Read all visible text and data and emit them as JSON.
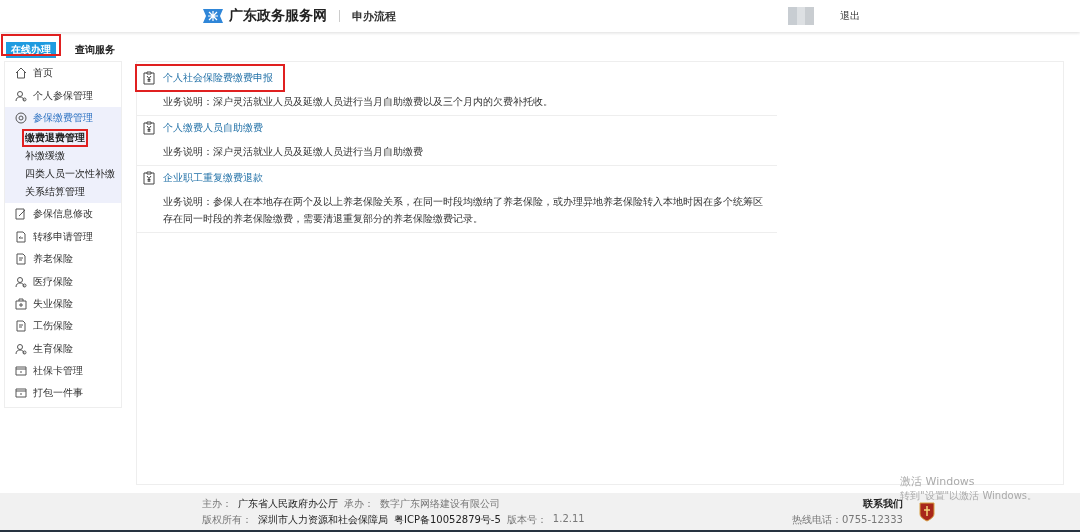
{
  "header": {
    "site_name": "广东政务服务网",
    "section": "申办流程",
    "logout": "退出"
  },
  "tabs": [
    {
      "label": "在线办理",
      "selected": true,
      "annotated": true
    },
    {
      "label": "查询服务",
      "selected": false,
      "annotated": false
    }
  ],
  "sidebar": {
    "items": [
      {
        "label": "首页",
        "kind": "home",
        "expanded": false
      },
      {
        "label": "个人参保管理",
        "kind": "person",
        "expanded": false
      },
      {
        "label": "参保缴费管理",
        "kind": "coin",
        "expanded": true,
        "children": [
          {
            "label": "缴费退费管理",
            "selected": true,
            "annotated": true
          },
          {
            "label": "补缴缓缴",
            "selected": false,
            "annotated": false
          },
          {
            "label": "四类人员一次性补缴",
            "selected": false,
            "annotated": false
          },
          {
            "label": "关系结算管理",
            "selected": false,
            "annotated": false
          }
        ]
      },
      {
        "label": "参保信息修改",
        "kind": "edit",
        "expanded": false
      },
      {
        "label": "转移申请管理",
        "kind": "transfer",
        "expanded": false
      },
      {
        "label": "养老保险",
        "kind": "doc",
        "expanded": false
      },
      {
        "label": "医疗保险",
        "kind": "person",
        "expanded": false
      },
      {
        "label": "失业保险",
        "kind": "bag",
        "expanded": false
      },
      {
        "label": "工伤保险",
        "kind": "doc",
        "expanded": false
      },
      {
        "label": "生育保险",
        "kind": "person",
        "expanded": false
      },
      {
        "label": "社保卡管理",
        "kind": "card",
        "expanded": false
      },
      {
        "label": "打包一件事",
        "kind": "card",
        "expanded": false
      }
    ]
  },
  "services": [
    {
      "title": "个人社会保险费缴费申报",
      "description": "业务说明：深户灵活就业人员及延缴人员进行当月自助缴费以及三个月内的欠费补托收。",
      "annotated": true
    },
    {
      "title": "个人缴费人员自助缴费",
      "description": "业务说明：深户灵活就业人员及延缴人员进行当月自助缴费",
      "annotated": false
    },
    {
      "title": "企业职工重复缴费退款",
      "description": "业务说明：参保人在本地存在两个及以上养老保险关系，在同一时段均缴纳了养老保险，或办理异地养老保险转入本地时因在多个统筹区存在同一时段的养老保险缴费，需要清退重复部分的养老保险缴费记录。",
      "annotated": false
    }
  ],
  "footer": {
    "host_label": "主办：",
    "host": "广东省人民政府办公厅",
    "undertaker_label": "承办：",
    "undertaker": "数字广东网络建设有限公司",
    "copyright_label": "版权所有：",
    "copyright": "深圳市人力资源和社会保障局",
    "icp": "粤ICP备10052879号-5",
    "version_label": "版本号：",
    "version": "1.2.11",
    "contact": "联系我们",
    "hotline": "热线电话：0755-12333"
  },
  "os_notice": {
    "title": "激活 Windows",
    "message": "转到\"设置\"以激活 Windows。"
  }
}
